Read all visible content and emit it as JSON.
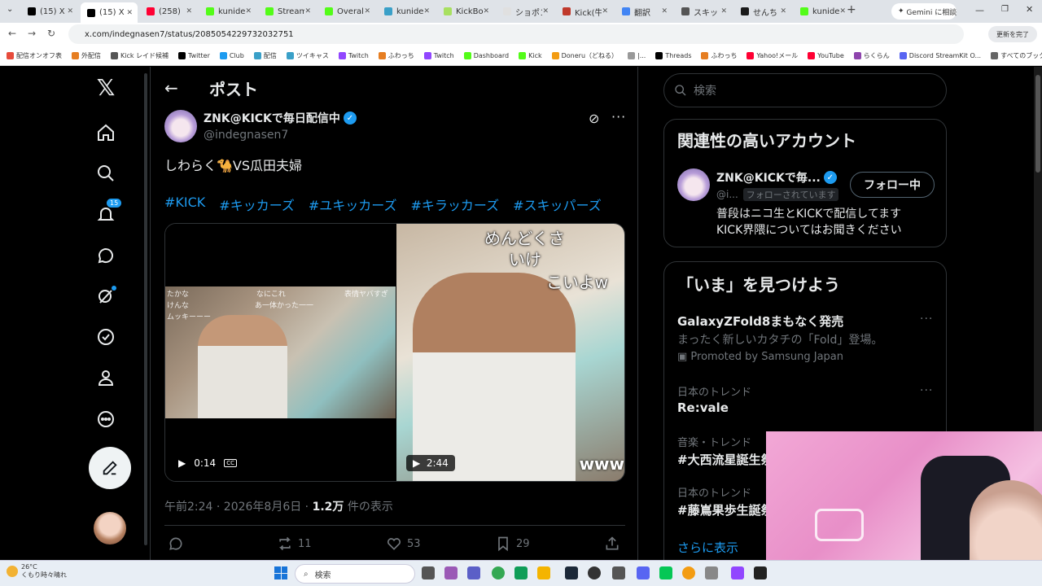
{
  "browser": {
    "tabs": [
      {
        "label": "(15) X",
        "color": "#000000"
      },
      {
        "label": "(15) X",
        "color": "#000000"
      },
      {
        "label": "(258)",
        "color": "#ff0033"
      },
      {
        "label": "kunide",
        "color": "#53fc18"
      },
      {
        "label": "Stream",
        "color": "#53fc18"
      },
      {
        "label": "Overal",
        "color": "#53fc18"
      },
      {
        "label": "kunide",
        "color": "#3aa0c8"
      },
      {
        "label": "KickBo",
        "color": "#a8e060"
      },
      {
        "label": "ショポン",
        "color": "#e0e0e0"
      },
      {
        "label": "Kick(牛",
        "color": "#c0392b"
      },
      {
        "label": "翻訳",
        "color": "#4285f4"
      },
      {
        "label": "スキッ",
        "color": "#555555"
      },
      {
        "label": "せんち",
        "color": "#1a1a1a"
      },
      {
        "label": "kunide",
        "color": "#53fc18"
      }
    ],
    "gemini_label": "Gemini に相談",
    "url": "x.com/indegnasen7/status/2085054229732032751",
    "update_label": "更新を完了",
    "bookmarks": [
      "配信オンオフ表",
      "外配信",
      "Kick レイド候補",
      "Twitter",
      "Club",
      "配信",
      "ツイキャス",
      "Twitch",
      "ふわっち",
      "Twitch",
      "Dashboard",
      "Kick",
      "Doneru（どねる）",
      "|...",
      "Threads",
      "ふわっち",
      "Yahoo!メール",
      "YouTube",
      "らくらん",
      "Discord StreamKit O...",
      "すべてのブックマーク"
    ]
  },
  "nav": {
    "notif_count": "15"
  },
  "post": {
    "header_title": "ポスト",
    "author_name": "ZNK@KICKで毎日配信中",
    "author_handle": "@indegnasen7",
    "text": "しわらく🐪VS瓜田夫婦",
    "hashtags": [
      "#KICK",
      "#キッカーズ",
      "#ユキッカーズ",
      "#キラッカーズ",
      "#スキッパーズ"
    ],
    "video1": {
      "duration": "0:14",
      "comments": [
        "たかな",
        "なにこれ",
        "表情ヤバすぎ",
        "けんな",
        "あ一体かった一一",
        "ムッキーーー"
      ]
    },
    "video2": {
      "duration": "2:44",
      "comments": [
        "めんどくさ",
        "いけ",
        "こいよw",
        "www"
      ]
    },
    "time": "午前2:24 · 2026年8月6日 · ",
    "views": "1.2万",
    "views_suffix": " 件の表示",
    "reply_count": "",
    "retweet_count": "11",
    "like_count": "53",
    "bookmark_count": "29"
  },
  "sidebar": {
    "search_placeholder": "検索",
    "related_title": "関連性の高いアカウント",
    "related": {
      "name": "ZNK@KICKで毎...",
      "handle": "@i...",
      "follows_you": "フォローされています",
      "follow_label": "フォロー中",
      "bio_line1": "普段はニコ生とKICKで配信してます",
      "bio_line2": "KICK界隈についてはお聞きください"
    },
    "trends_title": "「いま」を見つけよう",
    "trends": [
      {
        "kicker": "",
        "title": "GalaxyZFold8まもなく発売",
        "desc": "まったく新しいカタチの「Fold」登場。",
        "promo": "Promoted by Samsung Japan"
      },
      {
        "kicker": "日本のトレンド",
        "title": "Re:vale",
        "desc": "",
        "promo": ""
      },
      {
        "kicker": "音楽・トレンド",
        "title": "#大西流星誕生祭",
        "desc": "",
        "promo": ""
      },
      {
        "kicker": "日本のトレンド",
        "title": "#藤嶌果歩生誕祭",
        "desc": "",
        "promo": ""
      }
    ],
    "show_more": "さらに表示"
  },
  "taskbar": {
    "temp": "26°C",
    "weather": "くもり時々晴れ",
    "search_label": "検索"
  },
  "colors": {
    "accent": "#1d9bf0",
    "bg": "#000000",
    "text": "#e7e9ea",
    "muted": "#71767b"
  }
}
